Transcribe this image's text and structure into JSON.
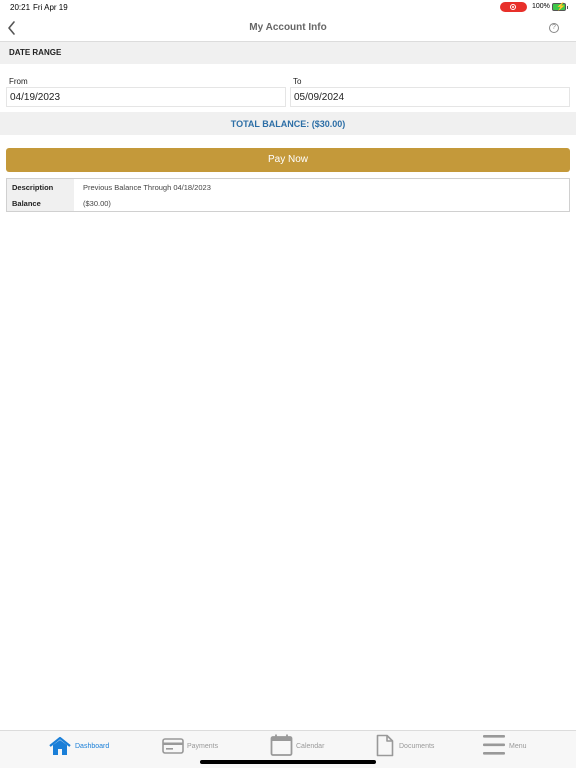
{
  "status_bar": {
    "time": "20:21",
    "date": "Fri Apr 19",
    "battery": "100%"
  },
  "nav": {
    "title": "My Account Info",
    "help_glyph": "?"
  },
  "date_range": {
    "header": "DATE RANGE",
    "from_label": "From",
    "from_value": "04/19/2023",
    "to_label": "To",
    "to_value": "05/09/2024"
  },
  "balance": {
    "text": "TOTAL BALANCE: ($30.00)"
  },
  "pay_button": {
    "label": "Pay Now",
    "color": "#c4993a"
  },
  "details": [
    {
      "key": "Description",
      "value": "Previous Balance Through 04/18/2023"
    },
    {
      "key": "Balance",
      "value": "($30.00)"
    }
  ],
  "tabs": [
    {
      "label": "Dashboard",
      "icon": "home-icon",
      "active": true
    },
    {
      "label": "Payments",
      "icon": "credit-card-icon",
      "active": false
    },
    {
      "label": "Calendar",
      "icon": "calendar-icon",
      "active": false
    },
    {
      "label": "Documents",
      "icon": "document-icon",
      "active": false
    },
    {
      "label": "Menu",
      "icon": "menu-icon",
      "active": false
    }
  ],
  "colors": {
    "accent_blue": "#1a7fd8",
    "balance_blue": "#2c6ea6",
    "gold": "#c4993a"
  }
}
